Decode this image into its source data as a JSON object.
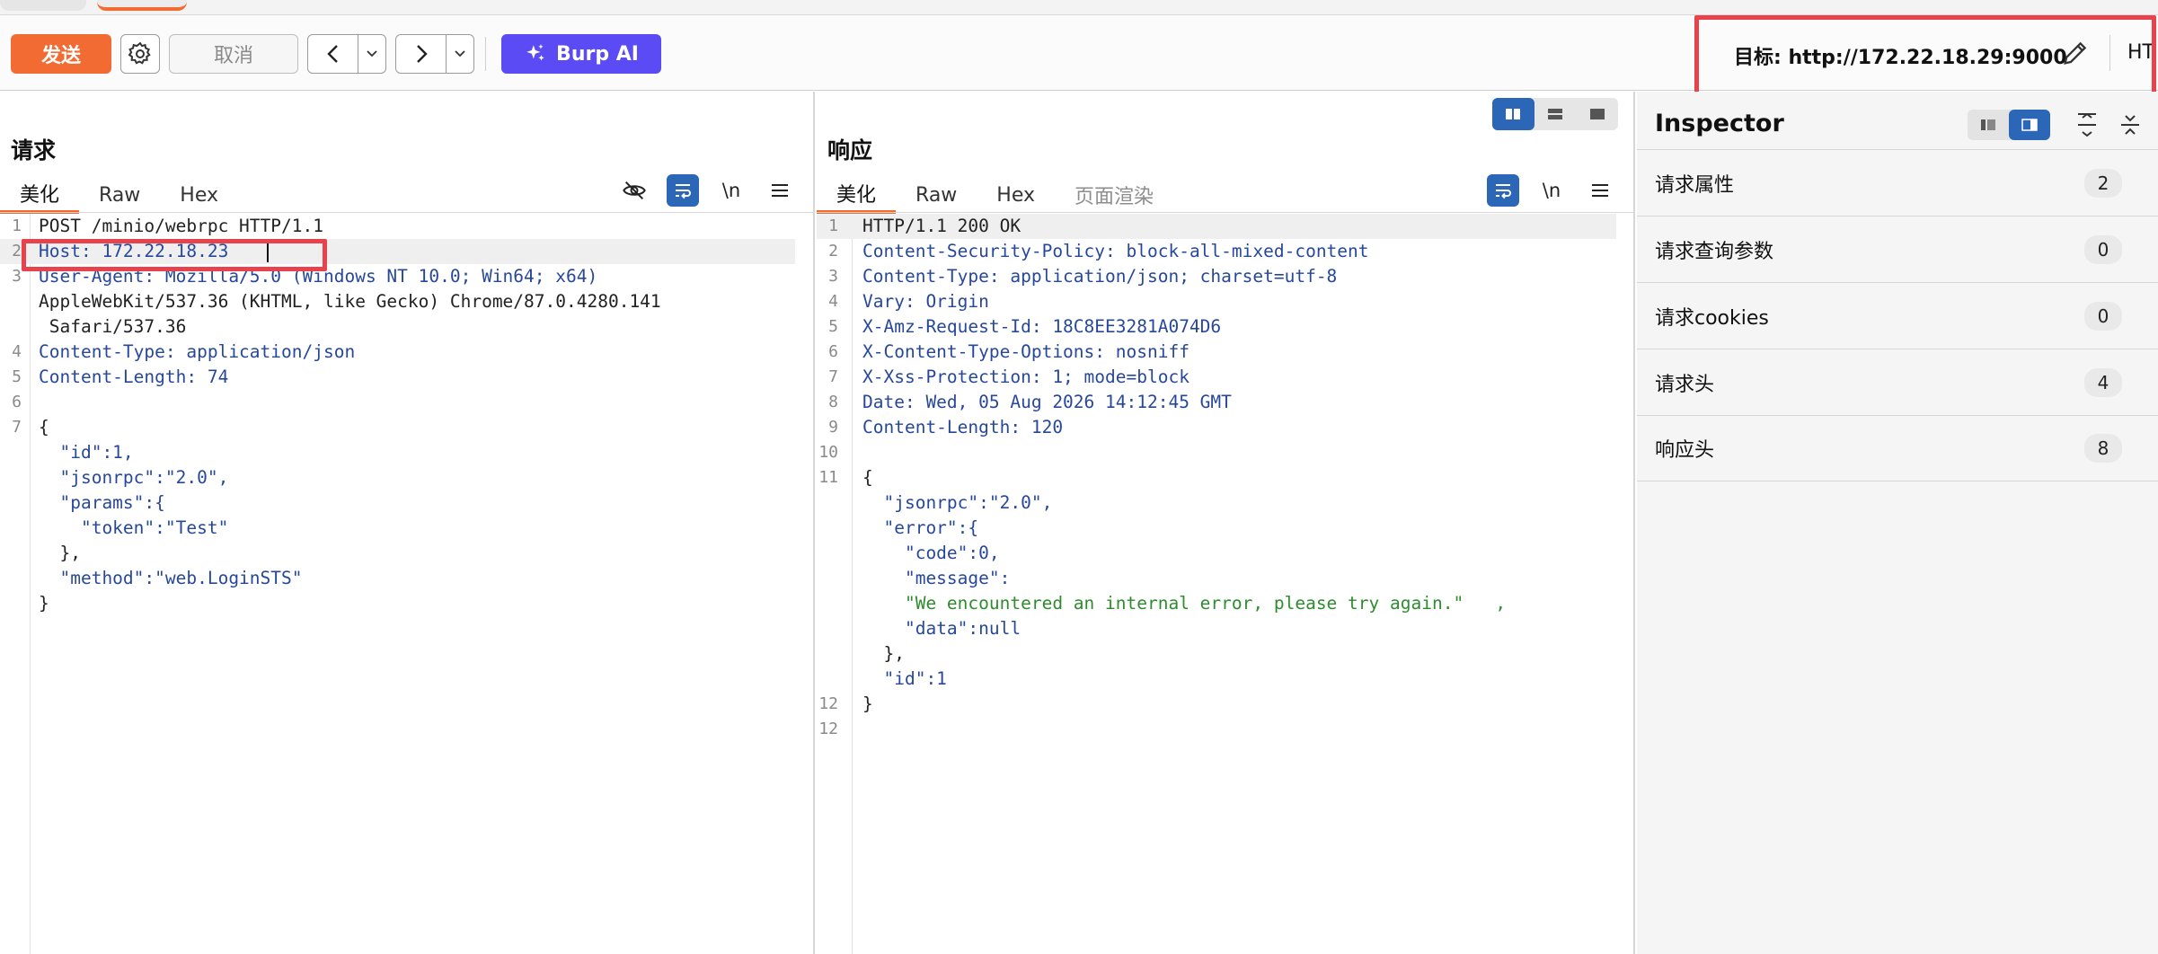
{
  "toolbar": {
    "send_label": "发送",
    "cancel_label": "取消",
    "burp_ai_label": "Burp AI",
    "target_label": "目标: http://172.22.18.29:9000",
    "http_label": "HT"
  },
  "request": {
    "title": "请求",
    "tabs": [
      "美化",
      "Raw",
      "Hex"
    ],
    "active_tab": "美化",
    "line_numbers": [
      "1",
      "2",
      "3",
      "",
      "",
      "4",
      "5",
      "6",
      "7",
      "",
      "",
      "",
      "",
      "",
      "",
      ""
    ],
    "lines": [
      "POST /minio/webrpc HTTP/1.1",
      "Host: 172.22.18.23",
      "User-Agent: Mozilla/5.0 (Windows NT 10.0; Win64; x64)",
      "AppleWebKit/537.36 (KHTML, like Gecko) Chrome/87.0.4280.141",
      " Safari/537.36",
      "Content-Type: application/json",
      "Content-Length: 74",
      "",
      "{",
      "  \"id\":1,",
      "  \"jsonrpc\":\"2.0\",",
      "  \"params\":{",
      "    \"token\":\"Test\"",
      "  },",
      "  \"method\":\"web.LoginSTS\"",
      "}"
    ]
  },
  "response": {
    "title": "响应",
    "tabs": [
      "美化",
      "Raw",
      "Hex",
      "页面渲染"
    ],
    "active_tab": "美化",
    "line_numbers": [
      "1",
      "2",
      "3",
      "4",
      "5",
      "6",
      "7",
      "8",
      "9",
      "10",
      "11",
      "",
      "",
      "",
      "",
      "",
      "",
      "",
      "",
      "12"
    ],
    "lines": [
      "HTTP/1.1 200 OK",
      "Content-Security-Policy: block-all-mixed-content",
      "Content-Type: application/json; charset=utf-8",
      "Vary: Origin",
      "X-Amz-Request-Id: 18C8EE3281A074D6",
      "X-Content-Type-Options: nosniff",
      "X-Xss-Protection: 1; mode=block",
      "Date: Wed, 05 Aug 2026 14:12:45 GMT",
      "Content-Length: 120",
      "",
      "{",
      "  \"jsonrpc\":\"2.0\",",
      "  \"error\":{",
      "    \"code\":0,",
      "    \"message\":",
      "    \"We encountered an internal error, please try again.\"   ,",
      "    \"data\":null",
      "  },",
      "  \"id\":1",
      "}",
      ""
    ]
  },
  "inspector": {
    "title": "Inspector",
    "rows": [
      {
        "label": "请求属性",
        "count": "2"
      },
      {
        "label": "请求查询参数",
        "count": "0"
      },
      {
        "label": "请求cookies",
        "count": "0"
      },
      {
        "label": "请求头",
        "count": "4"
      },
      {
        "label": "响应头",
        "count": "8"
      }
    ]
  },
  "colors": {
    "accent": "#f26b33",
    "burp_ai": "#5b4bf5",
    "highlight_box": "#e8424c",
    "header_key": "#27489a",
    "string_value": "#2e8b2e"
  }
}
